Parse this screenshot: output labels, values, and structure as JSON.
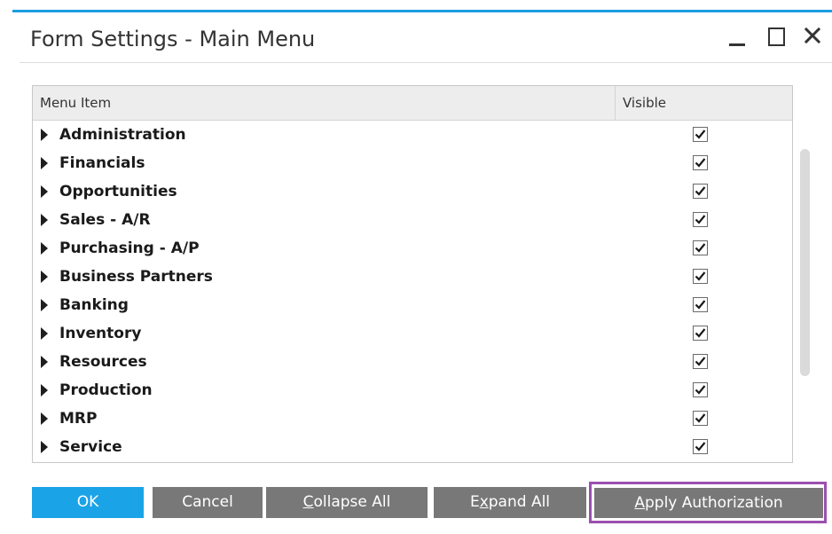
{
  "window": {
    "title": "Form Settings - Main Menu"
  },
  "grid": {
    "columns": {
      "menu_item": "Menu Item",
      "visible": "Visible"
    },
    "rows": [
      {
        "label": "Administration",
        "visible": true
      },
      {
        "label": "Financials",
        "visible": true
      },
      {
        "label": "Opportunities",
        "visible": true
      },
      {
        "label": "Sales - A/R",
        "visible": true
      },
      {
        "label": "Purchasing - A/P",
        "visible": true
      },
      {
        "label": "Business Partners",
        "visible": true
      },
      {
        "label": "Banking",
        "visible": true
      },
      {
        "label": "Inventory",
        "visible": true
      },
      {
        "label": "Resources",
        "visible": true
      },
      {
        "label": "Production",
        "visible": true
      },
      {
        "label": "MRP",
        "visible": true
      },
      {
        "label": "Service",
        "visible": true
      }
    ]
  },
  "buttons": {
    "ok": "OK",
    "cancel": "Cancel",
    "collapse_all": {
      "accel": "C",
      "rest": "ollapse All"
    },
    "expand_all": {
      "pre": "E",
      "accel": "x",
      "rest": "pand All"
    },
    "apply_authorization": {
      "accel": "A",
      "rest": "pply Authorization"
    }
  },
  "colors": {
    "accent": "#1b9de2",
    "ok_button": "#1ba3e8",
    "gray_button": "#787878",
    "highlight_border": "#9b4fae"
  },
  "icons": {
    "expander": "triangle-right-icon",
    "checkbox": "checkmark-icon",
    "minimize": "minimize-icon",
    "maximize": "maximize-icon",
    "close": "close-icon"
  }
}
